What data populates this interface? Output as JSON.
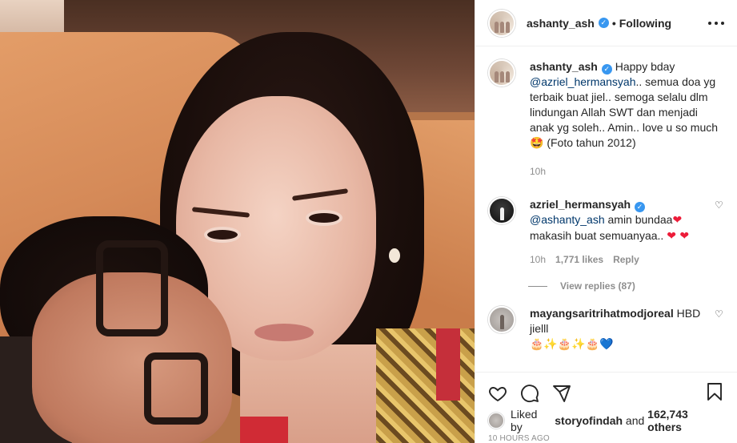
{
  "post": {
    "author": "ashanty_ash",
    "follow_status": "Following",
    "caption": {
      "user": "ashanty_ash",
      "text_before": "Happy bday",
      "mention": "@azriel_hermansyah",
      "text_after": ".. semua doa yg terbaik buat jiel.. semoga selalu dlm lindungan Allah SWT dan menjadi anak yg soleh.. Amin.. love u so much",
      "emoji": "🤩",
      "text_end": "(Foto tahun 2012)",
      "time": "10h"
    },
    "comments": [
      {
        "user": "azriel_hermansyah",
        "mention": "@ashanty_ash",
        "text": "amin bundaa",
        "emoji1": "❤",
        "text2": "makasih buat semuanyaa..",
        "emoji2": "❤ ❤",
        "time": "10h",
        "likes": "1,771 likes",
        "reply": "Reply",
        "view_replies": "View replies (87)"
      },
      {
        "user": "mayangsaritrihatmodjoreal",
        "text": "HBD jielll",
        "emojis": "🎂✨🎂✨🎂💙"
      }
    ],
    "liked_by": {
      "prefix": "Liked by",
      "user": "storyofindah",
      "conj": "and",
      "others": "162,743 others"
    },
    "timestamp": "10 HOURS AGO"
  },
  "icons": {
    "more": "more-options-icon",
    "like": "heart-icon",
    "comment": "comment-icon",
    "share": "share-icon",
    "save": "bookmark-icon"
  },
  "colors": {
    "verified": "#3897f0",
    "mention": "#00376b",
    "muted": "#8e8e8e"
  }
}
